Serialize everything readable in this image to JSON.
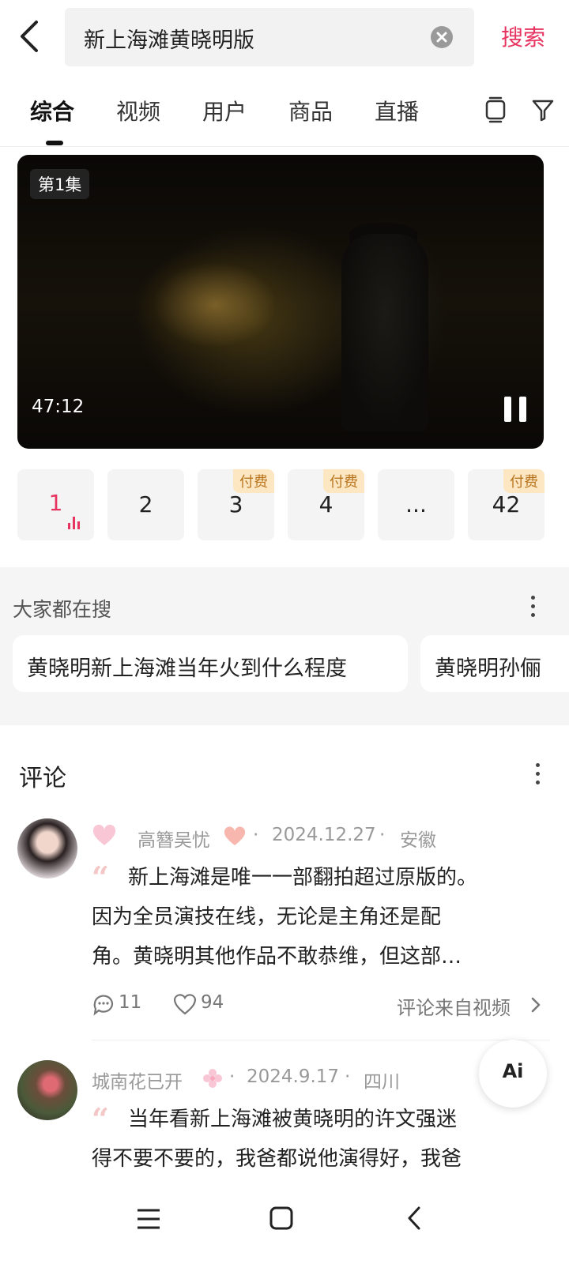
{
  "header": {
    "query": "新上海滩黄晓明版",
    "search_label": "搜索"
  },
  "tabs": [
    "综合",
    "视频",
    "用户",
    "商品",
    "直播"
  ],
  "video": {
    "episode_tag": "第1集",
    "duration": "47:12"
  },
  "episodes": [
    {
      "label": "1",
      "paid": "",
      "playing": true
    },
    {
      "label": "2",
      "paid": ""
    },
    {
      "label": "3",
      "paid": "付费"
    },
    {
      "label": "4",
      "paid": "付费"
    },
    {
      "label": "...",
      "paid": ""
    },
    {
      "label": "42",
      "paid": "付费"
    }
  ],
  "hot_search": {
    "title": "大家都在搜",
    "items": [
      "黄晓明新上海滩当年火到什么程度",
      "黄晓明孙俪"
    ]
  },
  "comments": {
    "title": "评论",
    "items": [
      {
        "user": "高簪吴忧",
        "date": "2024.12.27",
        "location": "安徽",
        "lines": [
          "新上海滩是唯一一部翻拍超过原版的。",
          "因为全员演技在线，无论是主角还是配",
          "角。黄晓明其他作品不敢恭维，但这部…"
        ],
        "replies": "11",
        "likes": "94",
        "source": "评论来自视频"
      },
      {
        "user": "城南花已开",
        "date": "2024.9.17",
        "location": "四川",
        "lines": [
          "当年看新上海滩被黄晓明的许文强迷",
          "得不要不要的，我爸都说他演得好，我爸"
        ]
      }
    ]
  },
  "ai_button": "Ai",
  "separator": "·"
}
